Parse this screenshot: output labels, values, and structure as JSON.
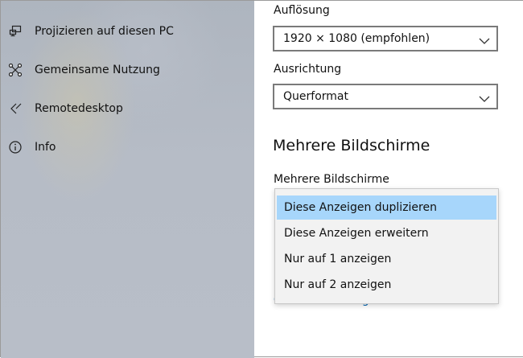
{
  "sidebar": {
    "items": [
      {
        "label": "Projizieren auf diesen PC",
        "icon": "project-to-pc-icon"
      },
      {
        "label": "Gemeinsame Nutzung",
        "icon": "shared-experiences-icon"
      },
      {
        "label": "Remotedesktop",
        "icon": "remote-desktop-icon"
      },
      {
        "label": "Info",
        "icon": "info-icon"
      }
    ]
  },
  "display": {
    "resolution_label": "Auflösung",
    "resolution_value": "1920 × 1080 (empfohlen)",
    "orientation_label": "Ausrichtung",
    "orientation_value": "Querformat",
    "multi_section_title": "Mehrere Bildschirme",
    "multi_label": "Mehrere Bildschirme",
    "multi_options": [
      "Diese Anzeigen duplizieren",
      "Diese Anzeigen erweitern",
      "Nur auf 1 anzeigen",
      "Nur auf 2 anzeigen"
    ],
    "multi_selected": "Diese Anzeigen duplizieren",
    "graphics_link": "Grafikeinstellungen"
  },
  "colors": {
    "accent_link": "#0063b1",
    "selected_option": "#a7d6fb"
  }
}
